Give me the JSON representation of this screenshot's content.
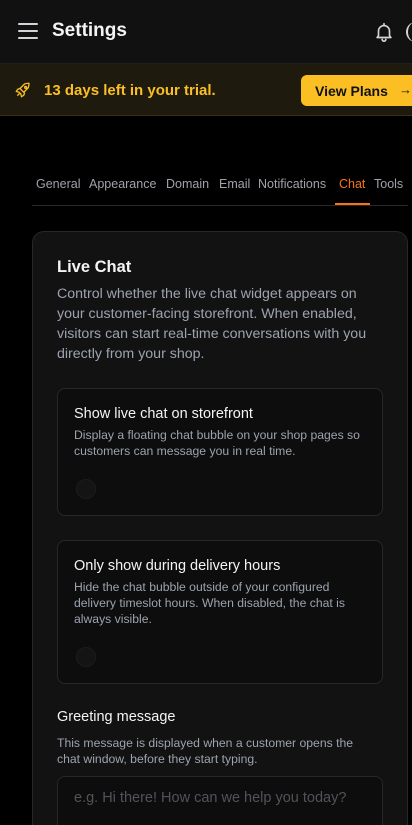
{
  "header": {
    "title": "Settings",
    "menu_icon": "hamburger-menu-icon",
    "notification_icon": "bell-icon"
  },
  "trial": {
    "icon": "rocket-icon",
    "text": "13 days left in your trial.",
    "button_label": "View Plans",
    "button_arrow": "→"
  },
  "tabs": [
    {
      "label": "General"
    },
    {
      "label": "Appearance"
    },
    {
      "label": "Domain"
    },
    {
      "label": "Email"
    },
    {
      "label": "Notifications"
    },
    {
      "label": "Chat",
      "active": true
    },
    {
      "label": "Tools"
    }
  ],
  "live_chat": {
    "title": "Live Chat",
    "description": "Control whether the live chat widget appears on your customer-facing storefront. When enabled, visitors can start real-time conversations with you directly from your shop.",
    "options": [
      {
        "title": "Show live chat on storefront",
        "description": "Display a floating chat bubble on your shop pages so customers can message you in real time."
      },
      {
        "title": "Only show during delivery hours",
        "description": "Hide the chat bubble outside of your configured delivery timeslot hours. When disabled, the chat is always visible."
      }
    ],
    "greeting": {
      "label": "Greeting message",
      "help": "This message is displayed when a customer opens the chat window, before they start typing.",
      "placeholder": "e.g. Hi there! How can we help you today?",
      "value": ""
    }
  },
  "colors": {
    "accent": "#f97316",
    "trial_text": "#fbbf24",
    "trial_button": "#fbbf24"
  }
}
